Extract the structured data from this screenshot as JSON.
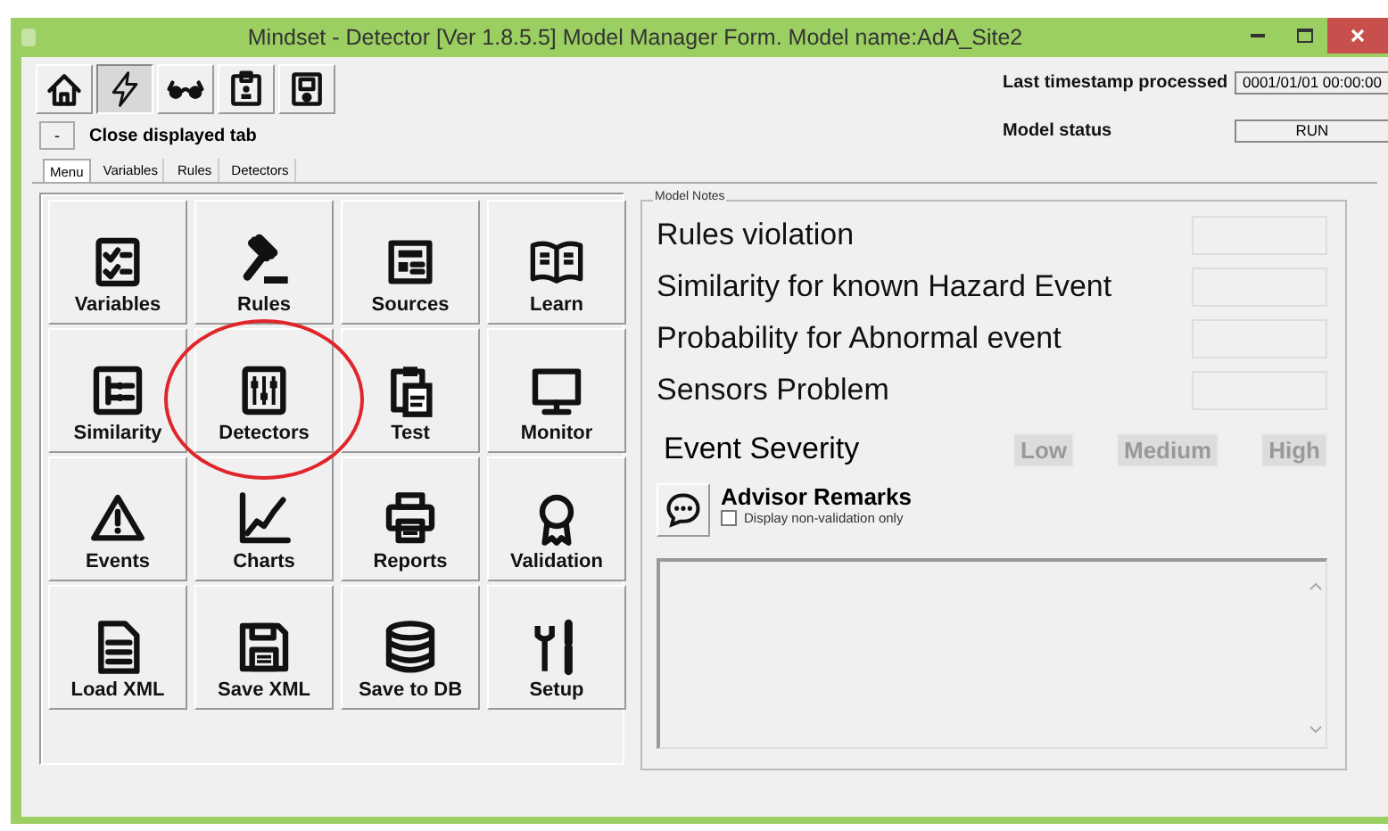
{
  "window": {
    "title": "Mindset - Detector [Ver 1.8.5.5] Model Manager Form.  Model name:AdA_Site2"
  },
  "toolbar": [
    {
      "selected": false
    },
    {
      "selected": true
    },
    {
      "selected": false
    },
    {
      "selected": false
    },
    {
      "selected": false
    }
  ],
  "close_tab": {
    "button": "-",
    "label": "Close displayed tab"
  },
  "status": [
    {
      "label": "Last timestamp processed",
      "value": "0001/01/01 00:00:00"
    },
    {
      "label": "Model status",
      "value": "RUN"
    }
  ],
  "tabs": [
    {
      "label": "Menu",
      "selected": true
    },
    {
      "label": "Variables",
      "selected": false
    },
    {
      "label": "Rules",
      "selected": false
    },
    {
      "label": "Detectors",
      "selected": false
    }
  ],
  "menu_buttons": [
    {
      "label": "Variables",
      "highlighted": false
    },
    {
      "label": "Rules",
      "highlighted": false
    },
    {
      "label": "Sources",
      "highlighted": false
    },
    {
      "label": "Learn",
      "highlighted": false
    },
    {
      "label": "Similarity",
      "highlighted": false
    },
    {
      "label": "Detectors",
      "highlighted": true
    },
    {
      "label": "Test",
      "highlighted": false
    },
    {
      "label": "Monitor",
      "highlighted": false
    },
    {
      "label": "Events",
      "highlighted": false
    },
    {
      "label": "Charts",
      "highlighted": false
    },
    {
      "label": "Reports",
      "highlighted": false
    },
    {
      "label": "Validation",
      "highlighted": false
    },
    {
      "label": "Load XML",
      "highlighted": false
    },
    {
      "label": "Save XML",
      "highlighted": false
    },
    {
      "label": "Save to DB",
      "highlighted": false
    },
    {
      "label": "Setup",
      "highlighted": false
    }
  ],
  "model_notes": {
    "title": "Model Notes",
    "metrics": [
      {
        "label": "Rules violation"
      },
      {
        "label": "Similarity for known Hazard Event"
      },
      {
        "label": "Probability for Abnormal event"
      },
      {
        "label": "Sensors Problem"
      }
    ],
    "severity": {
      "label": "Event Severity",
      "levels": [
        {
          "label": "Low",
          "on": false
        },
        {
          "label": "Medium",
          "on": false
        },
        {
          "label": "High",
          "on": false
        }
      ]
    },
    "advisor": {
      "title": "Advisor Remarks",
      "filter": {
        "label": "Display non-validation only",
        "checked": false
      }
    }
  }
}
